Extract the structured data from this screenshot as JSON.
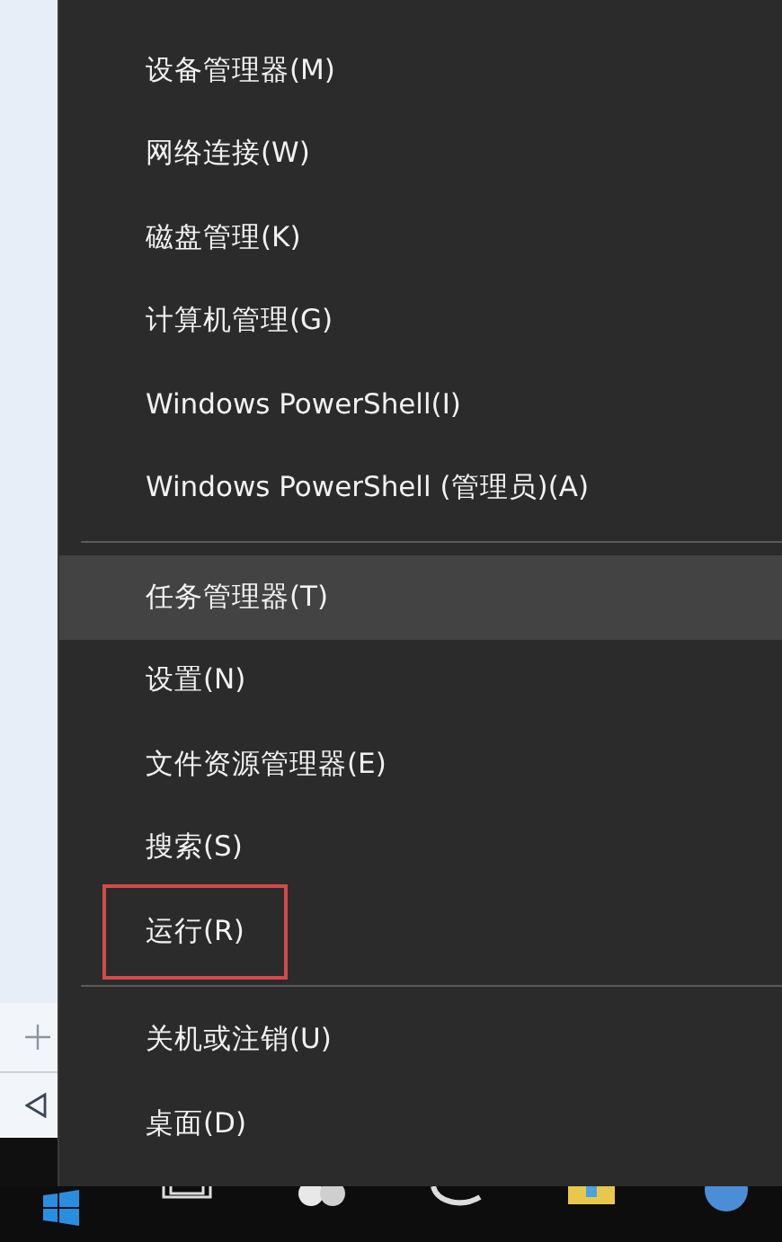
{
  "menu": {
    "groups": [
      {
        "items": [
          {
            "label": "设备管理器(M)",
            "selected": false,
            "marked": false
          },
          {
            "label": "网络连接(W)",
            "selected": false,
            "marked": false
          },
          {
            "label": "磁盘管理(K)",
            "selected": false,
            "marked": false
          },
          {
            "label": "计算机管理(G)",
            "selected": false,
            "marked": false
          },
          {
            "label": "Windows PowerShell(I)",
            "selected": false,
            "marked": false
          },
          {
            "label": "Windows PowerShell (管理员)(A)",
            "selected": false,
            "marked": false
          }
        ]
      },
      {
        "items": [
          {
            "label": "任务管理器(T)",
            "selected": true,
            "marked": false
          },
          {
            "label": "设置(N)",
            "selected": false,
            "marked": false
          },
          {
            "label": "文件资源管理器(E)",
            "selected": false,
            "marked": false
          },
          {
            "label": "搜索(S)",
            "selected": false,
            "marked": false
          },
          {
            "label": "运行(R)",
            "selected": false,
            "marked": true
          }
        ]
      },
      {
        "items": [
          {
            "label": "关机或注销(U)",
            "selected": false,
            "marked": false
          },
          {
            "label": "桌面(D)",
            "selected": false,
            "marked": false
          }
        ]
      }
    ]
  }
}
